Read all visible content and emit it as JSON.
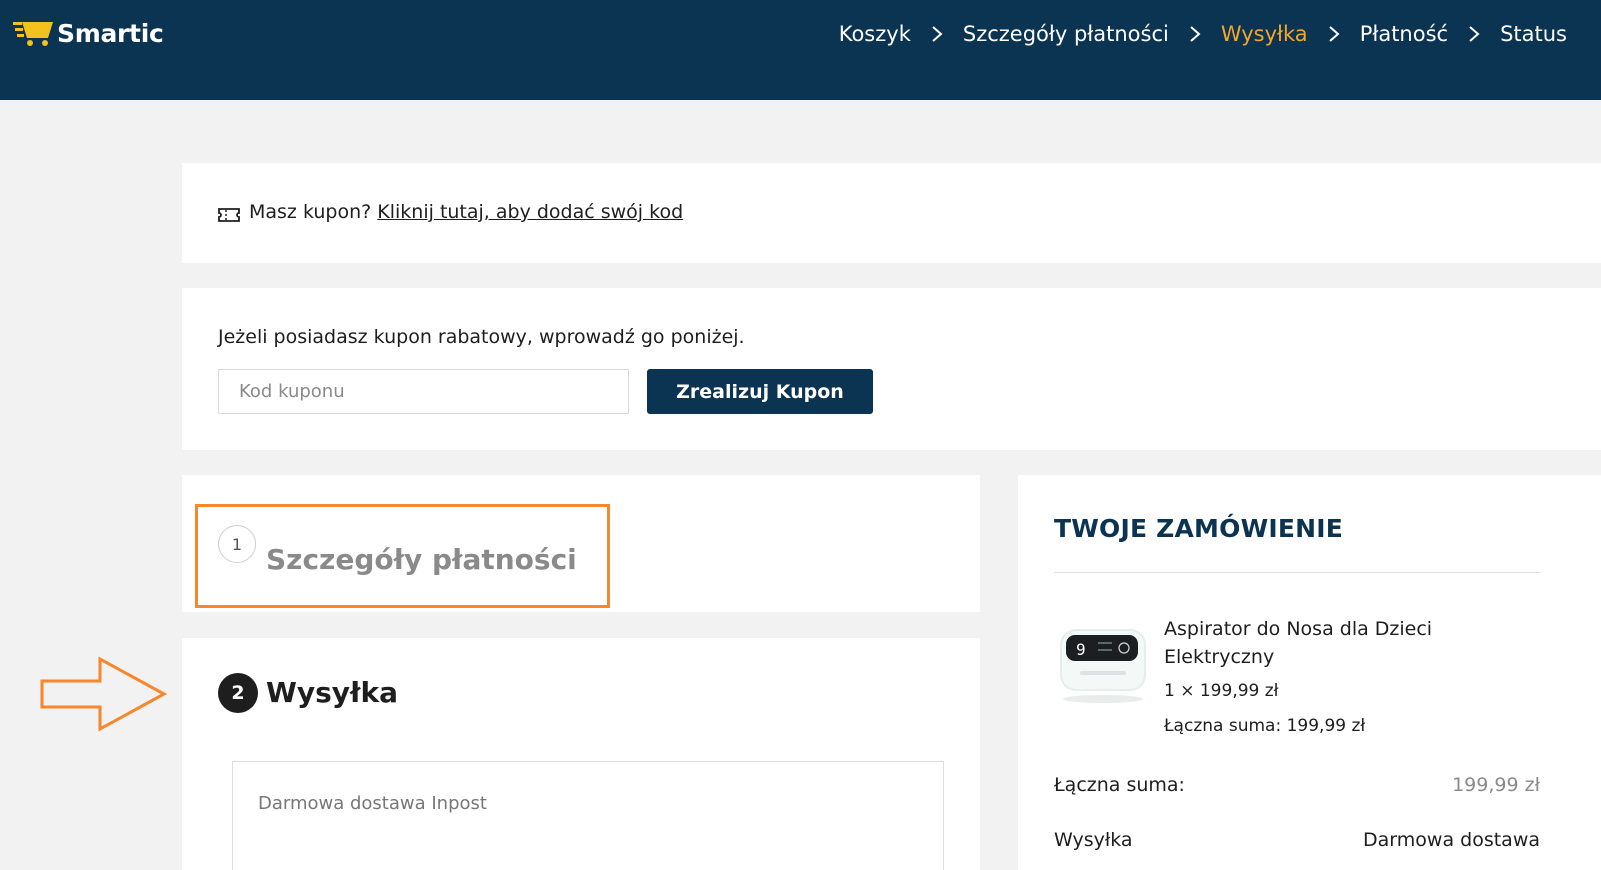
{
  "header": {
    "brand": "Smartic",
    "steps": [
      {
        "label": "Koszyk",
        "active": false
      },
      {
        "label": "Szczegóły płatności",
        "active": false
      },
      {
        "label": "Wysyłka",
        "active": true
      },
      {
        "label": "Płatność",
        "active": false
      },
      {
        "label": "Status",
        "active": false
      }
    ]
  },
  "coupon_notice": {
    "question": "Masz kupon?",
    "link": "Kliknij tutaj, aby dodać swój kod",
    "icon": "ticket-icon"
  },
  "coupon_form": {
    "help": "Jeżeli posiadasz kupon rabatowy, wprowadź go poniżej.",
    "placeholder": "Kod kuponu",
    "value": "",
    "button": "Zrealizuj Kupon"
  },
  "checkout_steps": {
    "step1": {
      "number": "1",
      "title": "Szczegóły płatności"
    },
    "step2": {
      "number": "2",
      "title": "Wysyłka",
      "option": "Darmowa dostawa Inpost"
    }
  },
  "order": {
    "title": "TWOJE ZAMÓWIENIE",
    "product": {
      "name": "Aspirator do Nosa dla Dzieci Elektryczny",
      "qty_price": "1 × 199,99 zł",
      "total_label": "Łączna suma:",
      "total_value": "199,99 zł"
    },
    "summary": {
      "total_label": "Łączna suma:",
      "total_value": "199,99 zł",
      "shipping_label": "Wysyłka",
      "shipping_value": "Darmowa dostawa"
    }
  },
  "colors": {
    "header_bg": "#0b3352",
    "active_step": "#f4a62a",
    "highlight": "#f7872b",
    "button_bg": "#0b3352"
  }
}
